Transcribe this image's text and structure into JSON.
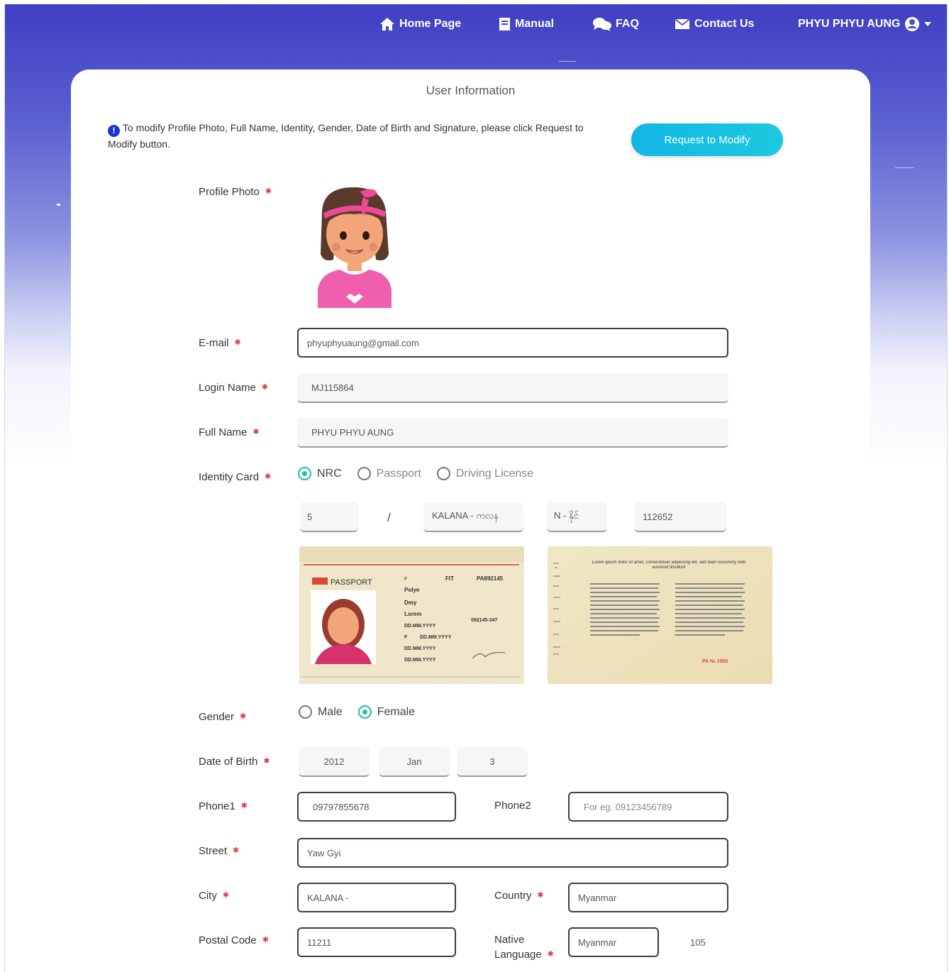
{
  "nav": {
    "home": "Home Page",
    "manual": "Manual",
    "faq": "FAQ",
    "contact": "Contact Us",
    "user": "PHYU PHYU AUNG"
  },
  "card": {
    "title": "User Information",
    "notice": "To modify Profile Photo, Full Name, Identity, Gender, Date of Birth and Signature, please click Request to Modify button.",
    "request_button": "Request to Modify"
  },
  "labels": {
    "profile_photo": "Profile Photo",
    "email": "E-mail",
    "login_name": "Login Name",
    "full_name": "Full Name",
    "identity_card": "Identity Card",
    "gender": "Gender",
    "dob": "Date of Birth",
    "phone1": "Phone1",
    "phone2": "Phone2",
    "street": "Street",
    "city": "City",
    "country": "Country",
    "postal_code": "Postal Code",
    "native_language_1": "Native",
    "native_language_2": "Language"
  },
  "values": {
    "email": "phyuphyuaung@gmail.com",
    "login_name": "MJ115864",
    "full_name": "PHYU PHYU AUNG",
    "phone1": "09797855678",
    "phone2_placeholder": "For eg. 09123456789",
    "street": "Yaw Gyi",
    "city": "KALANA -",
    "country": "Myanmar",
    "postal_code": "11211",
    "native_language": "Myanmar",
    "native_language_extra": "105"
  },
  "identity": {
    "options": [
      "NRC",
      "Passport",
      "Driving License"
    ],
    "selected": "NRC",
    "nrc_state": "5",
    "nrc_separator": "/",
    "nrc_township": "KALANA - ကလန",
    "nrc_type": "N - နိုင်",
    "nrc_number": "112652"
  },
  "passport_image": {
    "header": "PASSPORT",
    "number": "PA892145",
    "code": "FIT",
    "name_1": "Polye",
    "name_2": "Dmy",
    "name_3": "Lorem",
    "date_format": "DD.MM.YYYY",
    "sex": "F",
    "ref": "092145-347"
  },
  "back_image": {
    "heading": "Lorem ipsum dolor sit amet, consectetuer adipiscing elit, sed diam nonummy nibh euismod tincidunt",
    "stamp": "PA № 1000"
  },
  "gender": {
    "options": [
      "Male",
      "Female"
    ],
    "selected": "Female"
  },
  "dob": {
    "year": "2012",
    "month": "Jan",
    "day": "3"
  },
  "colors": {
    "nav_bg_top": "#3f3fc2",
    "accent": "#12b6e6",
    "radio_checked": "#1ec09a",
    "required": "#e0393e"
  }
}
